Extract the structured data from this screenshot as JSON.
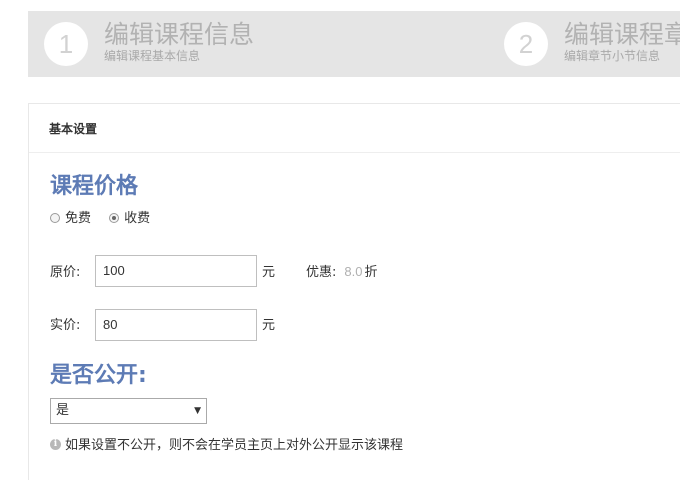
{
  "steps": [
    {
      "number": "1",
      "title": "编辑课程信息",
      "subtitle": "编辑课程基本信息"
    },
    {
      "number": "2",
      "title": "编辑课程章",
      "subtitle": "编辑章节小节信息"
    }
  ],
  "panel": {
    "title": "基本设置"
  },
  "price_section": {
    "title": "课程价格",
    "options": [
      {
        "label": "免费",
        "checked": false
      },
      {
        "label": "收费",
        "checked": true
      }
    ],
    "original": {
      "label": "原价:",
      "value": "100",
      "unit": "元"
    },
    "discount": {
      "label": "优惠:",
      "value": "8.0",
      "unit": "折"
    },
    "actual": {
      "label": "实价:",
      "value": "80",
      "unit": "元"
    }
  },
  "public_section": {
    "title": "是否公开:",
    "selected": "是",
    "hint": "如果设置不公开，则不会在学员主页上对外公开显示该课程"
  },
  "icons": {
    "info": "info-icon",
    "dropdown": "chevron-down-icon"
  }
}
